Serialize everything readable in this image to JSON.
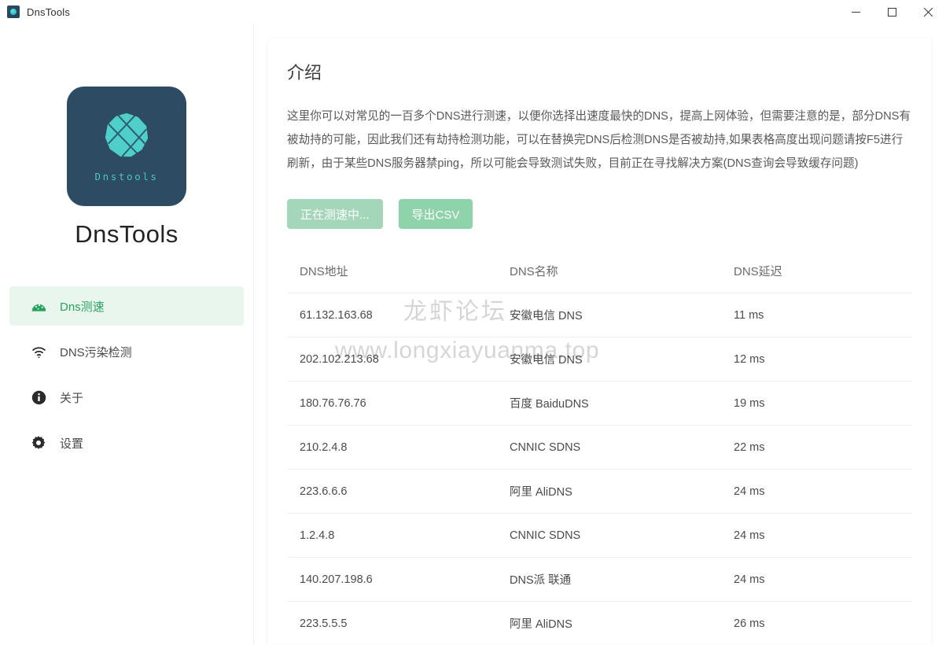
{
  "titlebar": {
    "app_name": "DnsTools",
    "icon": "app-logo-icon",
    "minimize": "minimize-icon",
    "maximize": "maximize-icon",
    "close": "close-icon"
  },
  "sidebar": {
    "logo_caption": "Dnstools",
    "brand_name": "DnsTools",
    "items": [
      {
        "label": "Dns测速",
        "icon": "speedometer-icon",
        "active": true
      },
      {
        "label": "DNS污染检测",
        "icon": "wifi-icon",
        "active": false
      },
      {
        "label": "关于",
        "icon": "info-icon",
        "active": false
      },
      {
        "label": "设置",
        "icon": "gear-icon",
        "active": false
      }
    ]
  },
  "main": {
    "intro_title": "介绍",
    "intro_body": "这里你可以对常见的一百多个DNS进行测速，以便你选择出速度最快的DNS，提高上网体验，但需要注意的是，部分DNS有被劫持的可能，因此我们还有劫持检测功能，可以在替换完DNS后检测DNS是否被劫持,如果表格高度出现问题请按F5进行刷新，由于某些DNS服务器禁ping，所以可能会导致测试失败，目前正在寻找解决方案(DNS查询会导致缓存问题)",
    "buttons": {
      "testing_label": "正在测速中...",
      "export_label": "导出CSV"
    },
    "table": {
      "columns": [
        "DNS地址",
        "DNS名称",
        "DNS延迟"
      ],
      "rows": [
        {
          "address": "61.132.163.68",
          "name": "安徽电信 DNS",
          "latency": "11 ms"
        },
        {
          "address": "202.102.213.68",
          "name": "安徽电信 DNS",
          "latency": "12 ms"
        },
        {
          "address": "180.76.76.76",
          "name": "百度 BaiduDNS",
          "latency": "19 ms"
        },
        {
          "address": "210.2.4.8",
          "name": "CNNIC SDNS",
          "latency": "22 ms"
        },
        {
          "address": "223.6.6.6",
          "name": "阿里 AliDNS",
          "latency": "24 ms"
        },
        {
          "address": "1.2.4.8",
          "name": "CNNIC SDNS",
          "latency": "24 ms"
        },
        {
          "address": "140.207.198.6",
          "name": "DNS派 联通",
          "latency": "24 ms"
        },
        {
          "address": "223.5.5.5",
          "name": "阿里 AliDNS",
          "latency": "26 ms"
        }
      ]
    },
    "watermark": {
      "chinese": "龙虾论坛",
      "url": "www.longxiayuanma.top"
    }
  },
  "colors": {
    "accent_green": "#2aa35f",
    "active_bg": "#e8f6ee",
    "button_green": "#8ed3a9",
    "button_muted": "#a4d7b9",
    "logo_navy": "#2d4b63",
    "logo_cyan": "#49c6c2"
  }
}
